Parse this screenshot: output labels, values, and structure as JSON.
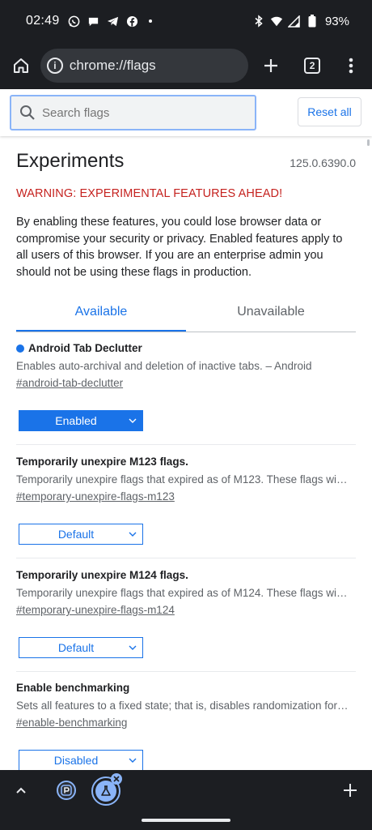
{
  "status_bar": {
    "time": "02:49",
    "battery": "93%"
  },
  "browser": {
    "url": "chrome://flags",
    "tab_count": "2"
  },
  "search": {
    "placeholder": "Search flags",
    "reset_label": "Reset all"
  },
  "page": {
    "title": "Experiments",
    "version": "125.0.6390.0",
    "warning": "WARNING: EXPERIMENTAL FEATURES AHEAD!",
    "description": "By enabling these features, you could lose browser data or compromise your security or privacy. Enabled features apply to all users of this browser. If you are an enterprise admin you should not be using these flags in production."
  },
  "tabs": [
    {
      "label": "Available",
      "active": true
    },
    {
      "label": "Unavailable",
      "active": false
    }
  ],
  "flags": [
    {
      "name": "Android Tab Declutter",
      "description": "Enables auto-archival and deletion of inactive tabs. – Android",
      "link": "#android-tab-declutter",
      "value": "Enabled",
      "modified": true
    },
    {
      "name": "Temporarily unexpire M123 flags.",
      "description": "Temporarily unexpire flags that expired as of M123. These flags will be removed soon.",
      "link": "#temporary-unexpire-flags-m123",
      "value": "Default",
      "modified": false
    },
    {
      "name": "Temporarily unexpire M124 flags.",
      "description": "Temporarily unexpire flags that expired as of M124. These flags will be removed soon.",
      "link": "#temporary-unexpire-flags-m124",
      "value": "Default",
      "modified": false
    },
    {
      "name": "Enable benchmarking",
      "description": "Sets all features to a fixed state; that is, disables randomization for field trials.",
      "link": "#enable-benchmarking",
      "value": "Disabled",
      "modified": false
    }
  ],
  "colors": {
    "accent": "#1a73e8",
    "warning": "#c5221f",
    "chrome_dark": "#1c1e22"
  }
}
